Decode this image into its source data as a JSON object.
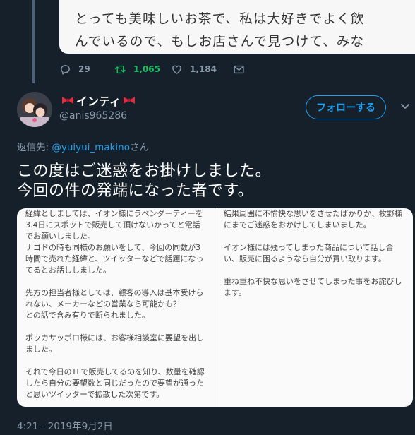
{
  "quoted_tweet": {
    "line1": "とっても美味しいお茶で、私は大好きでよく飲",
    "line2": "んでいるので、もしお店さんで見つけて、みな"
  },
  "actions": {
    "reply_count": "29",
    "retweet_count": "1,065",
    "like_count": "1,184"
  },
  "author": {
    "name": "インティ",
    "handle": "@anis965286",
    "follow_label": "フォローする"
  },
  "reply_to": {
    "prefix": "返信先: ",
    "mention": "@yuiyui_makino",
    "suffix": "さん"
  },
  "tweet": {
    "line1": "この度はご迷惑をお掛けしました。",
    "line2": "今回の件の発端になった者です。"
  },
  "memo": {
    "left_text": "経緯としましては、イオン様にラベンダーティーを\n3.4日にスポットで販売して頂けないかってと電話\nでお願いしました。\nナゴドの時も同様のお願いをして、今回の同数が3\n時間で売れた経緯と、ツイッターなどで話題になっ\nてるとお話ししました。\n\n先方の担当者様としては、顧客の導入は基本受けら\nれない、メーカーなどの営業なら可能かも？\nとの話で含み有りで断られました。\n\nポッカサッポロ様には、お客様相談室に要望を出し\nました。\n\nそれで今日のTLで販売してるのを知り、数量を確認\nしたら自分の要望数と同じだったので要望が通った\nと思いツイッターで拡散した次第です。",
    "right_text": "結果周囲に不愉快な思いをさせたばかりか、牧野様\nにまでご迷惑をおかけしてしまいました。\n\nイオン様には残ってしまった商品について話し合\nい、販売に困るようなら自分が買い取ります。\n\n重ね重ね不快な思いをさせてしまった事をお詫びし\nます。"
  },
  "timestamp": "4:21 - 2019年9月2日",
  "colors": {
    "background": "#15202b",
    "accent": "#1da1f2",
    "retweet": "#17bf63",
    "muted": "#8899a6"
  },
  "icons": [
    "reply-icon",
    "retweet-icon",
    "like-icon",
    "dm-icon",
    "bow-icon",
    "chevron-down-icon"
  ]
}
